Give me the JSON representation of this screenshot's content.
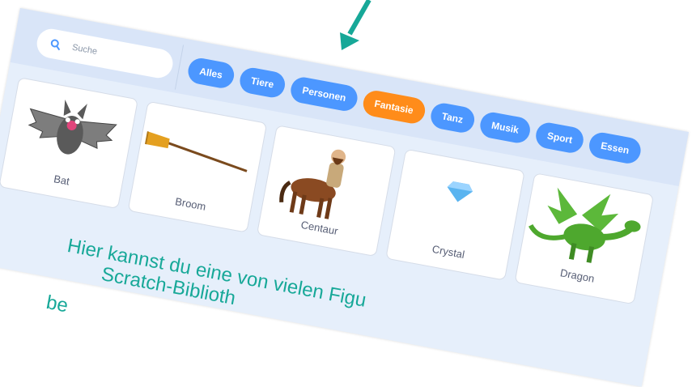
{
  "search": {
    "placeholder": "Suche"
  },
  "categories": [
    {
      "label": "Alles",
      "active": false
    },
    {
      "label": "Tiere",
      "active": false
    },
    {
      "label": "Personen",
      "active": false
    },
    {
      "label": "Fantasie",
      "active": true
    },
    {
      "label": "Tanz",
      "active": false
    },
    {
      "label": "Musik",
      "active": false
    },
    {
      "label": "Sport",
      "active": false
    },
    {
      "label": "Essen",
      "active": false
    }
  ],
  "sprites": [
    {
      "name": "Bat"
    },
    {
      "name": "Broom"
    },
    {
      "name": "Centaur"
    },
    {
      "name": "Crystal"
    },
    {
      "name": "Dragon"
    }
  ],
  "caption": {
    "line1": "Hier kannst du eine von vielen Figu",
    "line2": "Scratch-Biblioth",
    "line3": "be"
  },
  "colors": {
    "accent": "#4c97ff",
    "active": "#ff8c1a",
    "arrow": "#17a898",
    "caption": "#17a898"
  }
}
